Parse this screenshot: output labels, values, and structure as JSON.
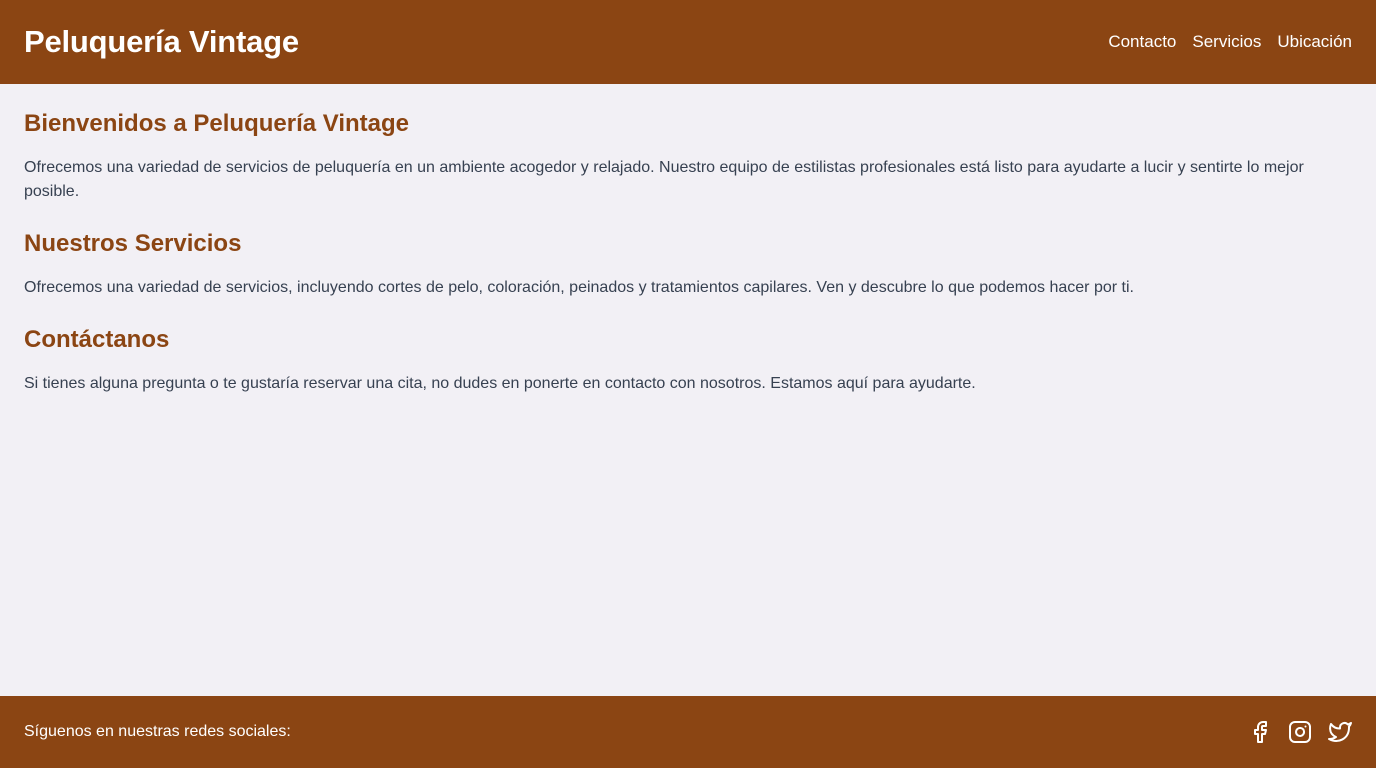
{
  "header": {
    "title": "Peluquería Vintage",
    "nav": [
      {
        "label": "Contacto"
      },
      {
        "label": "Servicios"
      },
      {
        "label": "Ubicación"
      }
    ]
  },
  "main": {
    "sections": [
      {
        "heading": "Bienvenidos a Peluquería Vintage",
        "text": "Ofrecemos una variedad de servicios de peluquería en un ambiente acogedor y relajado. Nuestro equipo de estilistas profesionales está listo para ayudarte a lucir y sentirte lo mejor posible."
      },
      {
        "heading": "Nuestros Servicios",
        "text": "Ofrecemos una variedad de servicios, incluyendo cortes de pelo, coloración, peinados y tratamientos capilares. Ven y descubre lo que podemos hacer por ti."
      },
      {
        "heading": "Contáctanos",
        "text": "Si tienes alguna pregunta o te gustaría reservar una cita, no dudes en ponerte en contacto con nosotros. Estamos aquí para ayudarte."
      }
    ]
  },
  "footer": {
    "text": "Síguenos en nuestras redes sociales:",
    "socials": [
      {
        "icon": "facebook-icon"
      },
      {
        "icon": "instagram-icon"
      },
      {
        "icon": "twitter-icon"
      }
    ]
  },
  "colors": {
    "brand": "#8b4513",
    "background": "#f2f0f5",
    "body_text": "#374151"
  }
}
